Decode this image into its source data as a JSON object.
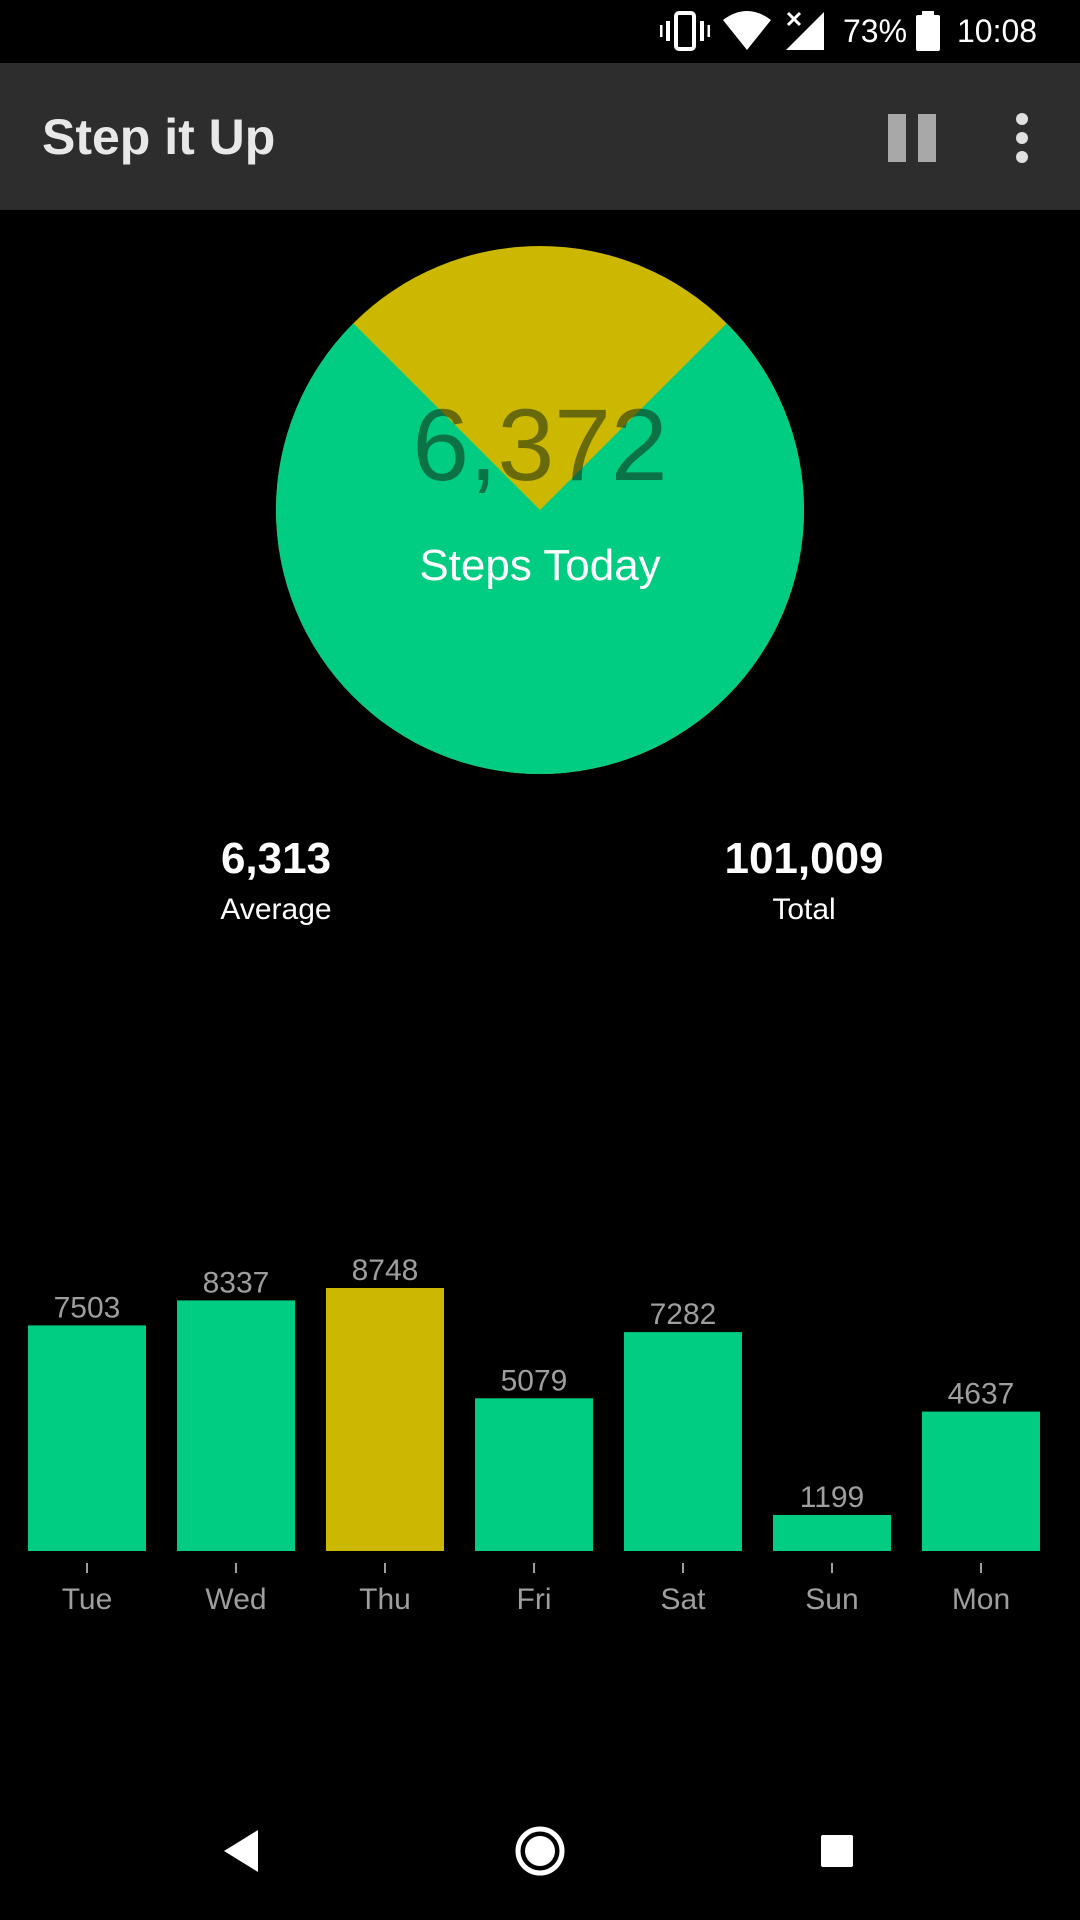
{
  "status_bar": {
    "battery_percent": "73%",
    "time": "10:08",
    "icons": [
      "vibrate-icon",
      "wifi-icon",
      "signal-icon",
      "battery-icon"
    ]
  },
  "app_bar": {
    "title": "Step it Up",
    "actions": [
      "pause-icon",
      "overflow-menu-icon"
    ]
  },
  "today": {
    "steps": "6,372",
    "label": "Steps Today",
    "goal_progress_fraction": 0.75
  },
  "stats": {
    "average": {
      "value": "6,313",
      "label": "Average"
    },
    "total": {
      "value": "101,009",
      "label": "Total"
    }
  },
  "colors": {
    "accent_green": "#00cc82",
    "accent_yellow": "#ccb800",
    "app_bar_bg": "#2d2d2d",
    "background": "#000000",
    "chart_text": "#9e9e9e"
  },
  "chart_data": {
    "type": "bar",
    "categories": [
      "Tue",
      "Wed",
      "Thu",
      "Fri",
      "Sat",
      "Sun",
      "Mon"
    ],
    "values": [
      7503,
      8337,
      8748,
      5079,
      7282,
      1199,
      4637
    ],
    "value_labels": [
      "7503",
      "8337",
      "8748",
      "5079",
      "7282",
      "1199",
      "4637"
    ],
    "highlight": "Thu",
    "title": "",
    "xlabel": "",
    "ylabel": "",
    "ylim": [
      0,
      8748
    ],
    "grid": false
  },
  "nav_bar": {
    "buttons": [
      "back-icon",
      "home-icon",
      "recents-icon"
    ]
  }
}
